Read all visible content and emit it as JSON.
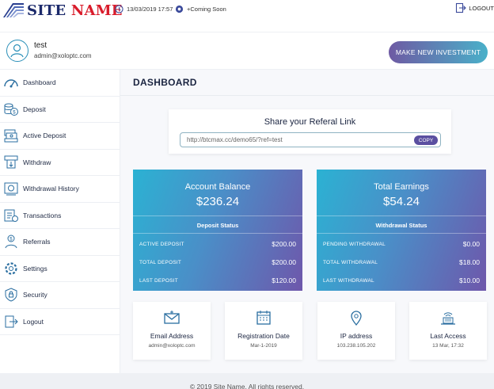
{
  "header": {
    "logo_site": "SITE",
    "logo_name": "NAME",
    "datetime": "13/03/2019 17:57",
    "coming_soon": "+Coming Soon",
    "logout_label": "LOGOUT"
  },
  "user": {
    "name": "test",
    "email": "admin@xoloptc.com",
    "invest_button": "MAKE NEW INVESTMENT"
  },
  "sidebar": {
    "items": [
      {
        "label": "Dashboard",
        "icon": "speedometer-icon"
      },
      {
        "label": "Deposit",
        "icon": "coins-icon"
      },
      {
        "label": "Active Deposit",
        "icon": "money-stack-icon"
      },
      {
        "label": "Withdraw",
        "icon": "cash-withdraw-icon"
      },
      {
        "label": "Withdrawal History",
        "icon": "history-icon"
      },
      {
        "label": "Transactions",
        "icon": "transactions-icon"
      },
      {
        "label": "Referrals",
        "icon": "referral-icon"
      },
      {
        "label": "Settings",
        "icon": "gear-icon"
      },
      {
        "label": "Security",
        "icon": "shield-lock-icon"
      },
      {
        "label": "Logout",
        "icon": "logout-icon"
      }
    ]
  },
  "main": {
    "title": "DASHBOARD",
    "referral": {
      "title": "Share your Referal Link",
      "link": "http://btcmax.cc/demo65/?ref=test",
      "copy_label": "COPY"
    },
    "balance": {
      "title": "Account Balance",
      "value": "$236.24",
      "sub_title": "Deposit Status",
      "rows": [
        {
          "label": "ACTIVE DEPOSIT",
          "value": "$200.00"
        },
        {
          "label": "TOTAL DEPOSIT",
          "value": "$200.00"
        },
        {
          "label": "LAST DEPOSIT",
          "value": "$120.00"
        }
      ]
    },
    "earnings": {
      "title": "Total Earnings",
      "value": "$54.24",
      "sub_title": "Withdrawal Status",
      "rows": [
        {
          "label": "PENDING WITHDRAWAL",
          "value": "$0.00"
        },
        {
          "label": "TOTAL WITHDRAWAL",
          "value": "$18.00"
        },
        {
          "label": "LAST WITHDRAWAL",
          "value": "$10.00"
        }
      ]
    },
    "info_cards": [
      {
        "title": "Email Address",
        "value": "admin@xoloptc.com",
        "icon": "envelope-icon"
      },
      {
        "title": "Registration Date",
        "value": "Mar-1-2019",
        "icon": "calendar-icon"
      },
      {
        "title": "IP address",
        "value": "103.238.105.202",
        "icon": "location-pin-icon"
      },
      {
        "title": "Last Access",
        "value": "13 Mar, 17:32",
        "icon": "wifi-laptop-icon"
      }
    ]
  },
  "footer": {
    "text": "© 2019 Site Name. All rights reserved."
  },
  "colors": {
    "accent": "#2a8fb8",
    "brand_navy": "#1c2a6b",
    "brand_red": "#d91c2b",
    "card_gradient_start": "#2bb2d3",
    "card_gradient_end": "#6e57ab"
  }
}
